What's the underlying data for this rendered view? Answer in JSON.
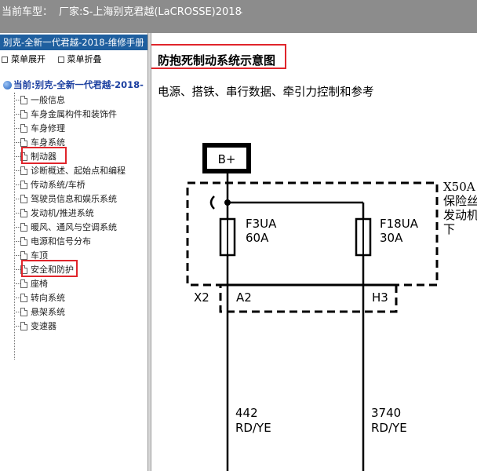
{
  "window": {
    "current_model_label": "当前车型：",
    "current_model_value": "厂家:S-上海别克君越(LaCROSSE)2018",
    "trailing_mark": "."
  },
  "sidebar": {
    "header": "别克-全新一代君越-2018-维修手册",
    "expand_label": "菜单展开",
    "collapse_label": "菜单折叠",
    "root": "当前:别克-全新一代君越-2018-",
    "items": [
      {
        "label": "一般信息"
      },
      {
        "label": "车身金属构件和装饰件"
      },
      {
        "label": "车身修理"
      },
      {
        "label": "车身系统"
      },
      {
        "label": "制动器",
        "highlighted": true
      },
      {
        "label": "诊断概述、起始点和编程"
      },
      {
        "label": "传动系统/车桥"
      },
      {
        "label": "驾驶员信息和娱乐系统"
      },
      {
        "label": "发动机/推进系统"
      },
      {
        "label": "暖风、通风与空调系统"
      },
      {
        "label": "电源和信号分布"
      },
      {
        "label": "车顶"
      },
      {
        "label": "安全和防护",
        "highlighted": true
      },
      {
        "label": "座椅"
      },
      {
        "label": "转向系统"
      },
      {
        "label": "悬架系统"
      },
      {
        "label": "变速器"
      }
    ],
    "highlight_color": "#e0252b"
  },
  "main": {
    "title": "防抱死制动系统示意图",
    "subtitle": "电源、搭铁、串行数据、牵引力控制和参考",
    "diagram": {
      "power_terminal": "B+",
      "fuse_box_id": "X50A",
      "fuse_box_desc_lines": [
        "保险丝",
        "发动机",
        "下"
      ],
      "fuses": [
        {
          "name": "F3UA",
          "rating": "60A"
        },
        {
          "name": "F18UA",
          "rating": "30A"
        }
      ],
      "connector": "X2",
      "pins": [
        "A2",
        "H3"
      ],
      "wires": [
        {
          "circuit": "442",
          "color": "RD/YE"
        },
        {
          "circuit": "3740",
          "color": "RD/YE"
        }
      ]
    }
  },
  "colors": {
    "topbar": "#8c8c8c",
    "sidebar_header": "#1f5f9f",
    "tree_root": "#1b3fa0",
    "highlight": "#e0252b"
  }
}
